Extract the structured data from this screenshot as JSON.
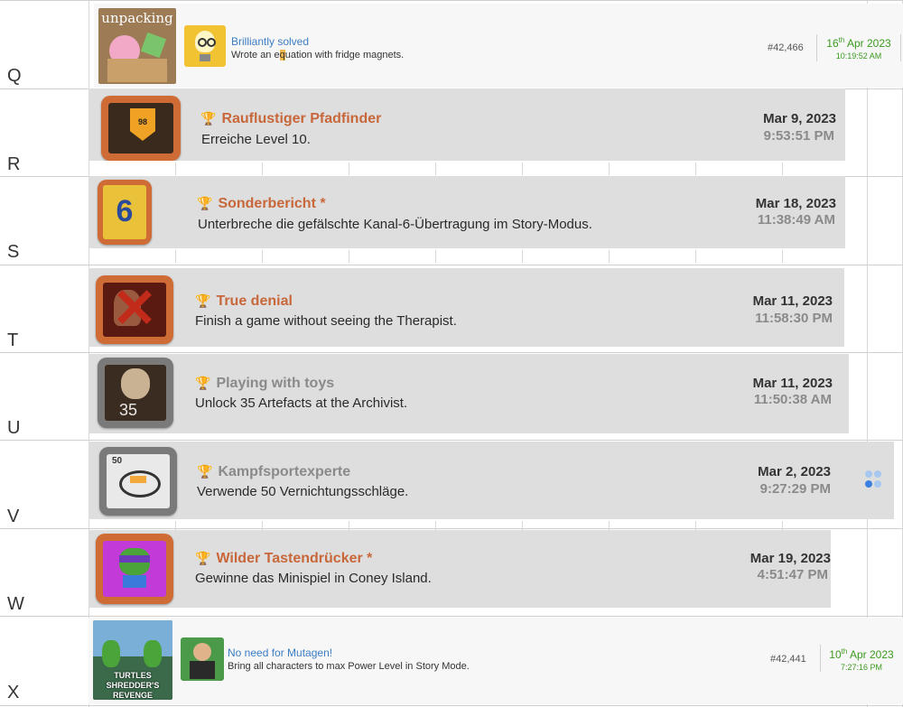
{
  "row_letters": [
    "Q",
    "R",
    "S",
    "T",
    "U",
    "V",
    "W",
    "X"
  ],
  "site_rows": [
    {
      "game_banner": "unpacking",
      "title": "Brilliantly solved",
      "desc_before": "Wrote an e",
      "desc_highlight": "q",
      "desc_after": "uation with fridge magnets.",
      "id": "#42,466",
      "date_day": "16",
      "date_sup": "th",
      "date_rest": " Apr 2023",
      "time": "10:19:52 AM"
    },
    {
      "game_banner": "TURTLES SHREDDER'S REVENGE",
      "title": "No need for Mutagen!",
      "desc": "Bring all characters to max Power Level in Story Mode.",
      "id": "#42,441",
      "date_day": "10",
      "date_sup": "th",
      "date_rest": " Apr 2023",
      "time": "7:27:16 PM"
    }
  ],
  "achievements": [
    {
      "title": "Rauflustiger Pfadfinder",
      "desc": "Erreiche Level 10.",
      "date": "Mar 9, 2023",
      "time": "9:53:51 PM",
      "badge_text": "98",
      "rarity": "bronze"
    },
    {
      "title": "Sonderbericht *",
      "desc": "Unterbreche die gefälschte Kanal-6-Übertragung im Story-Modus.",
      "date": "Mar 18, 2023",
      "time": "11:38:49 AM",
      "badge_text": "6",
      "rarity": "bronze"
    },
    {
      "title": "True denial",
      "desc": "Finish a game without seeing the Therapist.",
      "date": "Mar 11, 2023",
      "time": "11:58:30 PM",
      "rarity": "bronze"
    },
    {
      "title": "Playing with toys",
      "desc": "Unlock 35 Artefacts at the Archivist.",
      "date": "Mar 11, 2023",
      "time": "11:50:38 AM",
      "badge_text": "35",
      "rarity": "silver"
    },
    {
      "title": "Kampfsportexperte",
      "desc": "Verwende 50 Vernichtungsschläge.",
      "date": "Mar 2, 2023",
      "time": "9:27:29 PM",
      "badge_text": "50",
      "rarity": "silver"
    },
    {
      "title": "Wilder Tastendrücker *",
      "desc": "Gewinne das Minispiel in Coney Island.",
      "date": "Mar 19, 2023",
      "time": "4:51:47 PM",
      "rarity": "bronze"
    }
  ],
  "colors": {
    "bronze": "#c8673a",
    "silver": "#8a8a8a",
    "site_link": "#3c7dc4",
    "site_date": "#3b9a1f"
  }
}
